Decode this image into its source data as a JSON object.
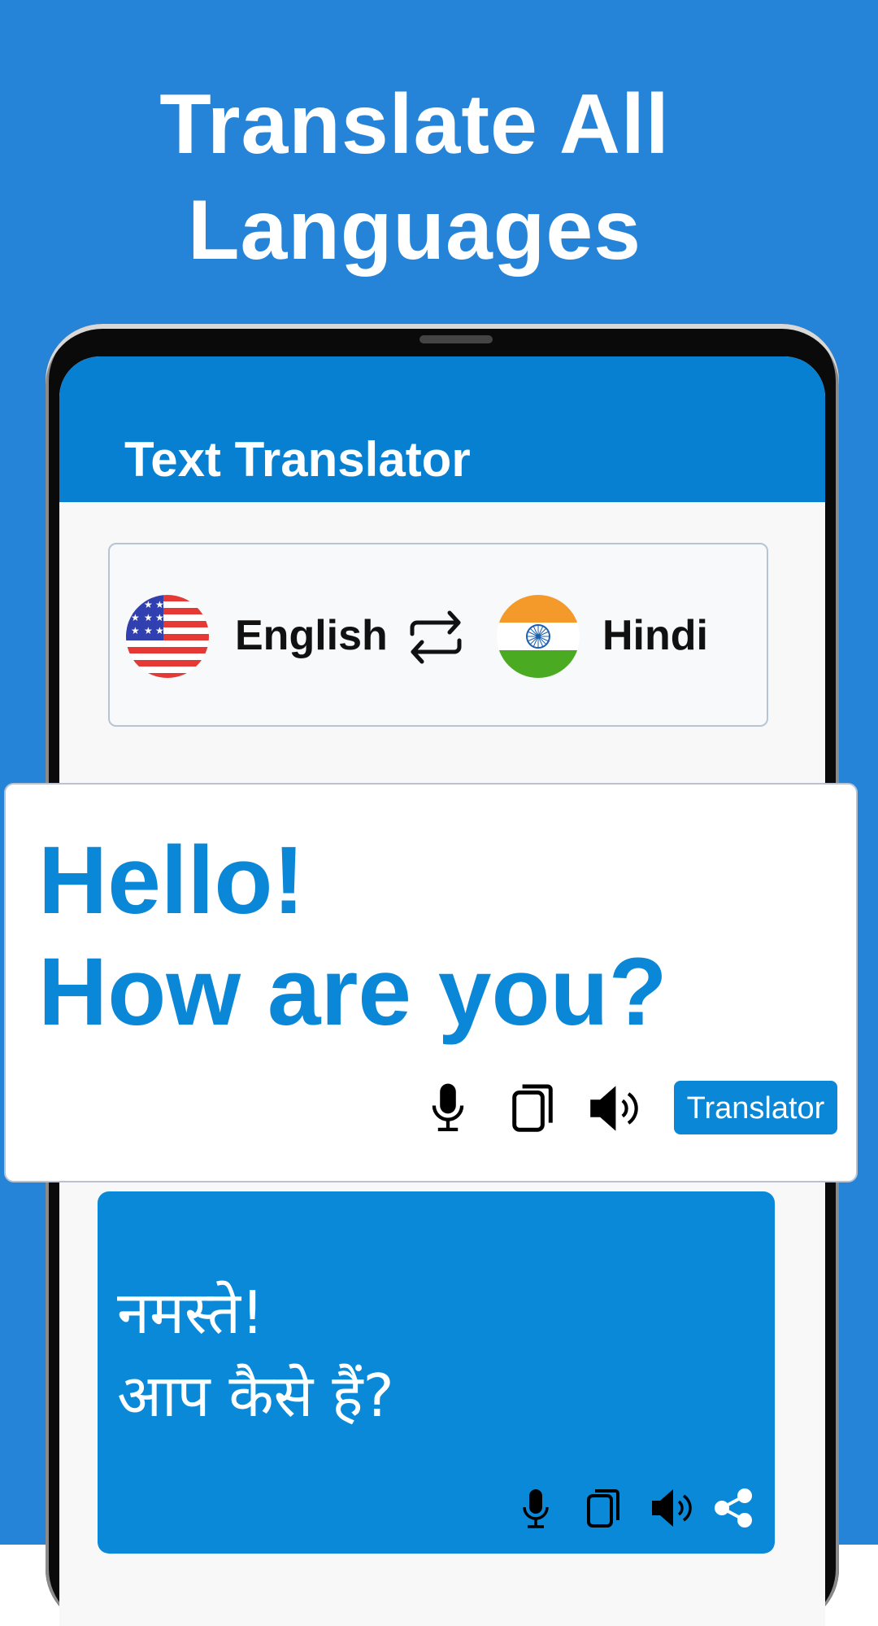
{
  "promo": {
    "headline_line1": "Translate All",
    "headline_line2": "Languages",
    "background_color": "#2684d8"
  },
  "app": {
    "title": "Text Translator",
    "header_color": "#0780d2"
  },
  "language_selector": {
    "source": {
      "name": "English",
      "flag_icon": "us-flag-icon"
    },
    "swap_icon": "swap-arrows-icon",
    "target": {
      "name": "Hindi",
      "flag_icon": "india-flag-icon"
    }
  },
  "input": {
    "text": "Hello!\nHow are you?",
    "text_color": "#0a87d7",
    "actions": [
      {
        "icon": "microphone-icon"
      },
      {
        "icon": "copy-icon"
      },
      {
        "icon": "speaker-icon"
      }
    ],
    "translate_button_label": "Translator"
  },
  "output": {
    "text": "नमस्ते!\nआप कैसे हैं?",
    "background_color": "#0a89d8",
    "actions": [
      {
        "icon": "microphone-icon"
      },
      {
        "icon": "copy-icon"
      },
      {
        "icon": "speaker-icon"
      },
      {
        "icon": "share-icon"
      }
    ]
  }
}
